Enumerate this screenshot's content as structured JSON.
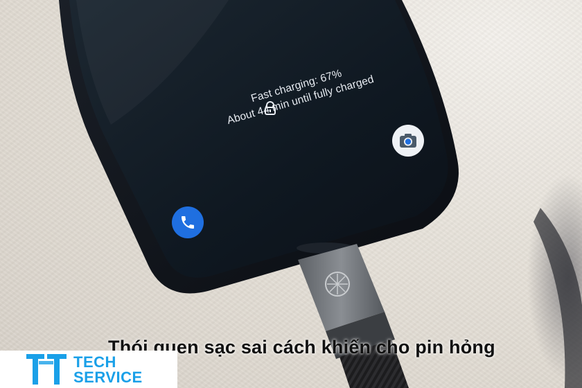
{
  "screen": {
    "charging_line": "Fast charging: 67%",
    "time_line": "About 44 min until fully charged"
  },
  "caption": "Thói quen sạc sai cách khiến cho pin hỏng",
  "logo": {
    "line1": "TECH",
    "line2": "SERVICE"
  },
  "icons": {
    "lock": "lock-icon",
    "camera": "camera-icon",
    "phone": "phone-icon",
    "cable_logo": "cable-logo-icon"
  },
  "colors": {
    "screen": "#0e1620",
    "accent_blue": "#1f6fe0",
    "logo_blue": "#1aa0e8"
  }
}
